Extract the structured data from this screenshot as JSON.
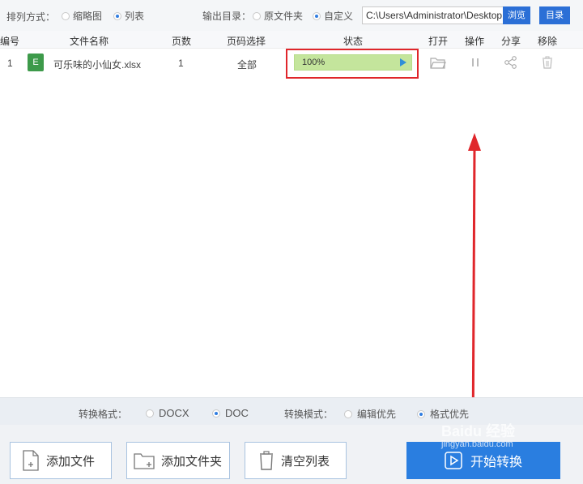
{
  "toolbar": {
    "sort_label": "排列方式：",
    "sort_options": [
      "缩略图",
      "列表"
    ],
    "sort_selected": "列表",
    "output_label": "输出目录：",
    "output_options": [
      "原文件夹",
      "自定义"
    ],
    "output_selected": "自定义",
    "path_value": "C:\\Users\\Administrator\\Desktop",
    "browse_label": "浏览",
    "dir_label": "目录"
  },
  "table": {
    "headers": [
      "编号",
      "文件名称",
      "页数",
      "页码选择",
      "状态",
      "打开",
      "操作",
      "分享",
      "移除"
    ],
    "rows": [
      {
        "index": "1",
        "file_icon": "E",
        "name": "可乐味的小仙女.xlsx",
        "pages": "1",
        "page_select": "全部",
        "status": "100%",
        "progress": 1.0
      }
    ]
  },
  "format_bar": {
    "format_label": "转换格式：",
    "format_options": [
      "DOCX",
      "DOC"
    ],
    "format_selected": "DOC",
    "mode_label": "转换模式：",
    "mode_options": [
      "编辑优先",
      "格式优先"
    ],
    "mode_selected": "格式优先"
  },
  "buttons": {
    "add_file": "添加文件",
    "add_folder": "添加文件夹",
    "clear_list": "清空列表",
    "start": "开始转换"
  },
  "watermark": "Baidu 经验",
  "watermark_sub": "jingyan.baidu.com",
  "colors": {
    "accent": "#2a7ee0",
    "highlight": "#e0262b",
    "progress": "#c4e59c"
  }
}
